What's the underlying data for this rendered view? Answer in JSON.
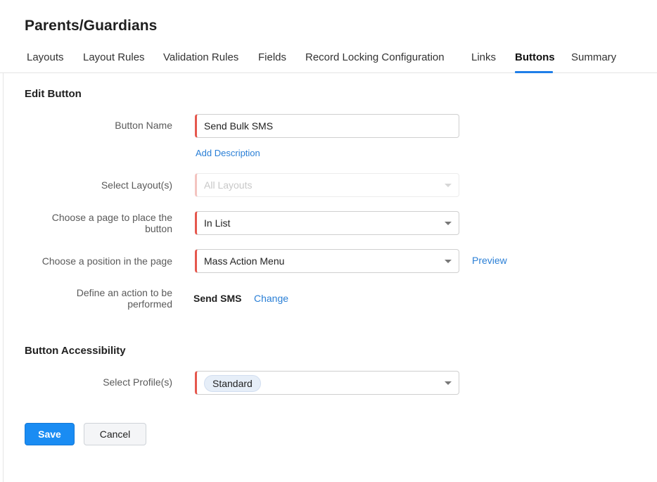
{
  "page": {
    "title": "Parents/Guardians"
  },
  "tabs": [
    {
      "label": "Layouts"
    },
    {
      "label": "Layout Rules"
    },
    {
      "label": "Validation Rules"
    },
    {
      "label": "Fields"
    },
    {
      "label": "Record Locking Configuration"
    },
    {
      "label": "Links"
    },
    {
      "label": "Buttons",
      "active": true
    },
    {
      "label": "Summary"
    }
  ],
  "edit_button": {
    "heading": "Edit Button",
    "button_name": {
      "label": "Button Name",
      "value": "Send Bulk SMS"
    },
    "add_description": "Add Description",
    "layouts": {
      "label": "Select Layout(s)",
      "value": "All Layouts"
    },
    "page_place": {
      "label_line1": "Choose a page to place the",
      "label_line2": "button",
      "value": "In List"
    },
    "position": {
      "label": "Choose a position in the page",
      "value": "Mass Action Menu",
      "preview": "Preview"
    },
    "action": {
      "label_line1": "Define an action to be",
      "label_line2": "performed",
      "value": "Send SMS",
      "change": "Change"
    }
  },
  "accessibility": {
    "heading": "Button Accessibility",
    "profiles": {
      "label": "Select Profile(s)",
      "chip": "Standard"
    }
  },
  "footer": {
    "save": "Save",
    "cancel": "Cancel"
  },
  "colors": {
    "accent": "#1f7ee8",
    "required_marker": "#e5574d",
    "save_button": "#1a8cf3",
    "link": "#2a7fd6"
  }
}
